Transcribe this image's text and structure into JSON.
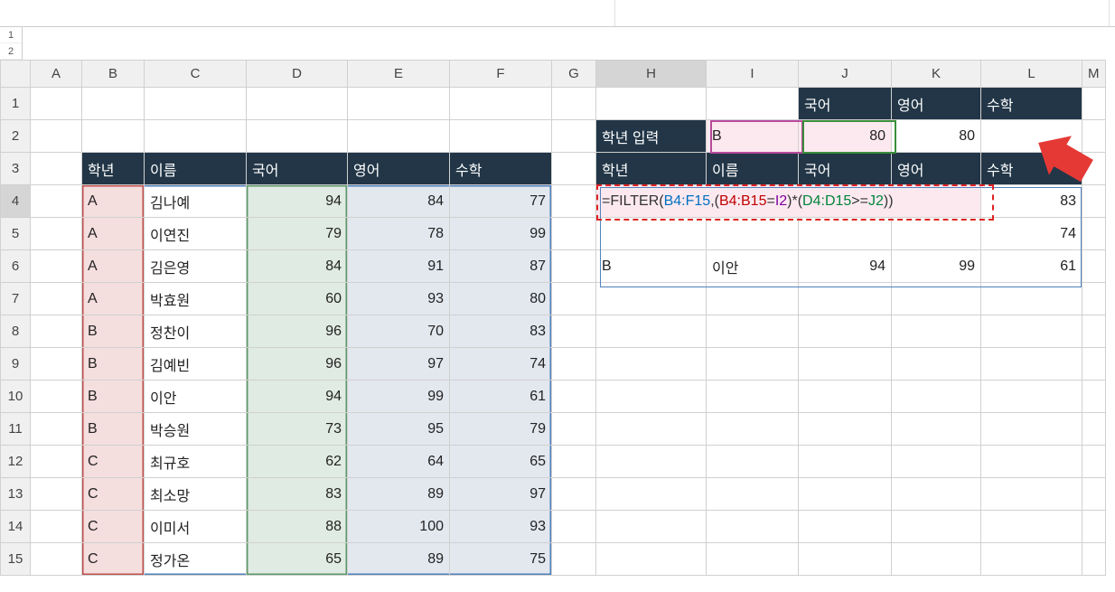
{
  "formula_display": "=FILTER(B4:F15,(B4:B15=I2)*(D4:D15>=J2))",
  "formula_parts": {
    "fn": "FILTER",
    "r1": "B4:F15",
    "r2": "B4:B15",
    "r3": "I2",
    "r4": "D4:D15",
    "r5": "J2"
  },
  "side_tabs": [
    "1",
    "2"
  ],
  "columns": [
    "A",
    "B",
    "C",
    "D",
    "E",
    "F",
    "G",
    "H",
    "I",
    "J",
    "K",
    "L",
    "M"
  ],
  "row_labels": [
    "1",
    "2",
    "3",
    "4",
    "5",
    "6",
    "7",
    "8",
    "9",
    "10",
    "11",
    "12",
    "13",
    "14",
    "15"
  ],
  "left_headers": {
    "grade": "학년",
    "name": "이름",
    "kor": "국어",
    "eng": "영어",
    "math": "수학"
  },
  "left_rows": [
    {
      "g": "A",
      "n": "김나예",
      "k": 94,
      "e": 84,
      "m": 77
    },
    {
      "g": "A",
      "n": "이연진",
      "k": 79,
      "e": 78,
      "m": 99
    },
    {
      "g": "A",
      "n": "김은영",
      "k": 84,
      "e": 91,
      "m": 87
    },
    {
      "g": "A",
      "n": "박효원",
      "k": 60,
      "e": 93,
      "m": 80
    },
    {
      "g": "B",
      "n": "정찬이",
      "k": 96,
      "e": 70,
      "m": 83
    },
    {
      "g": "B",
      "n": "김예빈",
      "k": 96,
      "e": 97,
      "m": 74
    },
    {
      "g": "B",
      "n": "이안",
      "k": 94,
      "e": 99,
      "m": 61
    },
    {
      "g": "B",
      "n": "박승원",
      "k": 73,
      "e": 95,
      "m": 79
    },
    {
      "g": "C",
      "n": "최규호",
      "k": 62,
      "e": 64,
      "m": 65
    },
    {
      "g": "C",
      "n": "최소망",
      "k": 83,
      "e": 89,
      "m": 97
    },
    {
      "g": "C",
      "n": "이미서",
      "k": 88,
      "e": 100,
      "m": 93
    },
    {
      "g": "C",
      "n": "정가온",
      "k": 65,
      "e": 89,
      "m": 75
    }
  ],
  "right": {
    "crit_headers": {
      "kor": "국어",
      "eng": "영어",
      "math": "수학"
    },
    "input_label": "학년 입력",
    "input_grade": "B",
    "input_kor": 80,
    "input_eng": 80,
    "result_headers": {
      "grade": "학년",
      "name": "이름",
      "kor": "국어",
      "eng": "영어",
      "math": "수학"
    },
    "result_rows": [
      {
        "g": "",
        "n": "",
        "k": "",
        "e": "",
        "m": 83
      },
      {
        "g": "",
        "n": "",
        "k": "",
        "e": "",
        "m": 74
      },
      {
        "g": "B",
        "n": "이안",
        "k": 94,
        "e": 99,
        "m": 61
      }
    ]
  }
}
